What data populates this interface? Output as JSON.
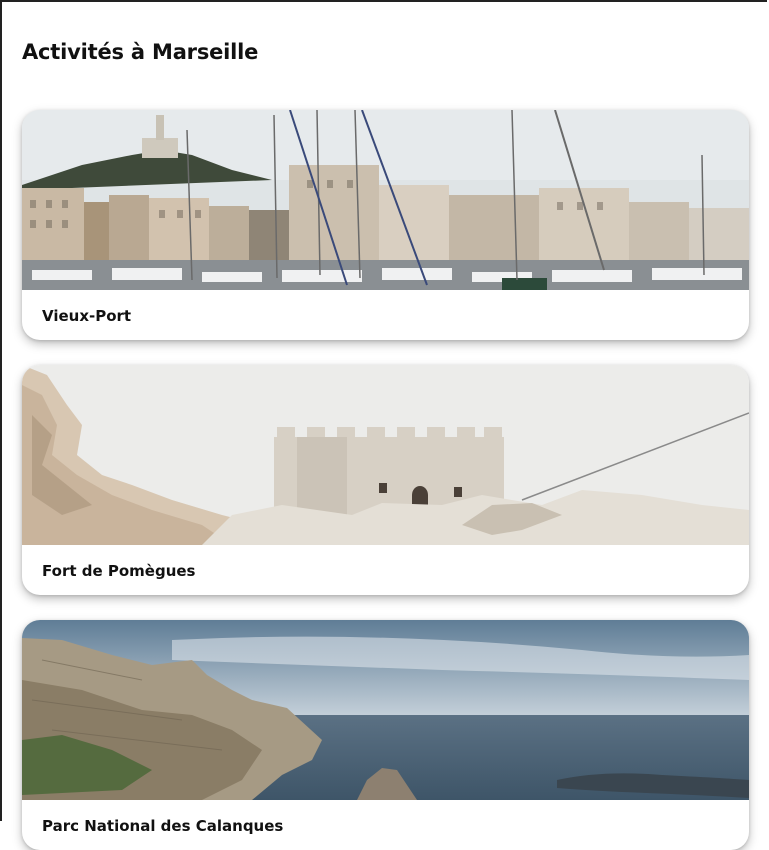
{
  "page": {
    "title": "Activités à Marseille"
  },
  "activities": [
    {
      "name": "Vieux-Port"
    },
    {
      "name": "Fort de Pomègues"
    },
    {
      "name": "Parc National des Calanques"
    }
  ]
}
